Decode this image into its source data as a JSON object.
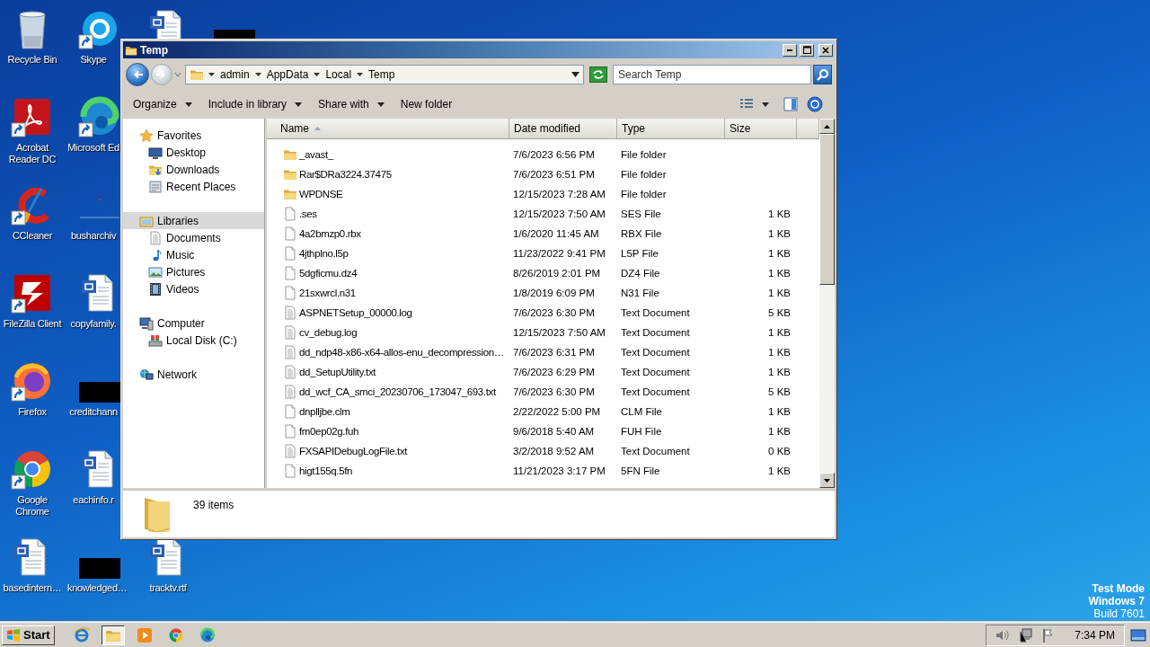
{
  "desktop": {
    "icon_columns": [
      [
        {
          "kind": "recycle-bin",
          "label_lines": [
            "Recycle Bin"
          ],
          "shortcut": false
        },
        {
          "kind": "acrobat",
          "label_lines": [
            "Acrobat",
            "Reader DC"
          ],
          "shortcut": true
        },
        {
          "kind": "ccleaner",
          "label_lines": [
            "CCleaner"
          ],
          "shortcut": true
        },
        {
          "kind": "filezilla",
          "label_lines": [
            "FileZilla Client"
          ],
          "shortcut": true
        },
        {
          "kind": "firefox",
          "label_lines": [
            "Firefox"
          ],
          "shortcut": true
        },
        {
          "kind": "chrome",
          "label_lines": [
            "Google",
            "Chrome"
          ],
          "shortcut": true
        },
        {
          "kind": "word",
          "label_lines": [
            "basedintern…"
          ],
          "shortcut": false
        }
      ],
      [
        {
          "kind": "skype",
          "label_lines": [
            "Skype"
          ],
          "shortcut": true
        },
        {
          "kind": "edge",
          "label_lines": [
            "Microsoft Ed"
          ],
          "shortcut": true
        },
        {
          "kind": "lines",
          "label_lines": [
            "busharchiv"
          ],
          "shortcut": false
        },
        {
          "kind": "word",
          "label_lines": [
            "copyfamily."
          ],
          "shortcut": false
        },
        {
          "kind": "redacted",
          "label_lines": [
            "creditchann"
          ],
          "shortcut": false
        },
        {
          "kind": "word",
          "label_lines": [
            "eachinfo.r"
          ],
          "shortcut": false
        },
        {
          "kind": "redacted",
          "label_lines": [
            "knowledged…"
          ],
          "shortcut": false
        }
      ],
      [
        {
          "kind": "word",
          "shortcut": false
        },
        {
          "kind": "word",
          "label_lines": [
            "tracktv.rtf"
          ],
          "shortcut": false
        }
      ],
      [
        {
          "kind": "redacted",
          "shortcut": false
        }
      ]
    ],
    "notice_lines": [
      "Test Mode",
      "Windows 7",
      "Build 7601"
    ]
  },
  "window": {
    "title": "Temp",
    "nav_buttons": [
      {
        "kind": "back",
        "disabled": false
      },
      {
        "kind": "forward",
        "disabled": true
      }
    ],
    "address": {
      "crumbs": [
        "admin",
        "AppData",
        "Local",
        "Temp"
      ]
    },
    "search": {
      "placeholder": "Search Temp"
    },
    "commands": [
      {
        "label": "Organize",
        "menu": true
      },
      {
        "label": "Include in library",
        "menu": true
      },
      {
        "label": "Share with",
        "menu": true
      },
      {
        "label": "New folder",
        "menu": false
      }
    ],
    "nav": [
      {
        "kind": "favorites",
        "label": "Favorites",
        "selected": false,
        "children": [
          {
            "kind": "desktop",
            "label": "Desktop",
            "selected": false
          },
          {
            "kind": "downloads",
            "label": "Downloads",
            "selected": false
          },
          {
            "kind": "recent",
            "label": "Recent Places",
            "selected": false
          }
        ]
      },
      {
        "kind": "libraries",
        "label": "Libraries",
        "selected": true,
        "children": [
          {
            "kind": "documents",
            "label": "Documents",
            "selected": false
          },
          {
            "kind": "music",
            "label": "Music",
            "selected": false
          },
          {
            "kind": "pictures",
            "label": "Pictures",
            "selected": false
          },
          {
            "kind": "videos",
            "label": "Videos",
            "selected": false
          }
        ]
      },
      {
        "kind": "computer",
        "label": "Computer",
        "selected": false,
        "children": [
          {
            "kind": "disk",
            "label": "Local Disk (C:)",
            "selected": false
          }
        ]
      },
      {
        "kind": "network",
        "label": "Network",
        "selected": false
      }
    ],
    "columns": [
      {
        "label": "Name",
        "sorted": true
      },
      {
        "label": "Date modified",
        "sorted": false
      },
      {
        "label": "Type",
        "sorted": false
      },
      {
        "label": "Size",
        "sorted": false
      }
    ],
    "files": [
      {
        "kind": "folder",
        "name": "_avast_",
        "date": "7/6/2023 6:56 PM",
        "type": "File folder"
      },
      {
        "kind": "folder",
        "name": "Rar$DRa3224.37475",
        "date": "7/6/2023 6:51 PM",
        "type": "File folder"
      },
      {
        "kind": "folder",
        "name": "WPDNSE",
        "date": "12/15/2023 7:28 AM",
        "type": "File folder"
      },
      {
        "kind": "file",
        "name": ".ses",
        "date": "12/15/2023 7:50 AM",
        "type": "SES File",
        "size": "1 KB"
      },
      {
        "kind": "file",
        "name": "4a2bmzp0.rbx",
        "date": "1/6/2020 11:45 AM",
        "type": "RBX File",
        "size": "1 KB"
      },
      {
        "kind": "file",
        "name": "4jthplno.l5p",
        "date": "11/23/2022 9:41 PM",
        "type": "L5P File",
        "size": "1 KB"
      },
      {
        "kind": "file",
        "name": "5dgficmu.dz4",
        "date": "8/26/2019 2:01 PM",
        "type": "DZ4 File",
        "size": "1 KB"
      },
      {
        "kind": "file",
        "name": "21sxwrcl.n31",
        "date": "1/8/2019 6:09 PM",
        "type": "N31 File",
        "size": "1 KB"
      },
      {
        "kind": "text",
        "name": "ASPNETSetup_00000.log",
        "date": "7/6/2023 6:30 PM",
        "type": "Text Document",
        "size": "5 KB"
      },
      {
        "kind": "text",
        "name": "cv_debug.log",
        "date": "12/15/2023 7:50 AM",
        "type": "Text Document",
        "size": "1 KB"
      },
      {
        "kind": "text",
        "name": "dd_ndp48-x86-x64-allos-enu_decompression…",
        "date": "7/6/2023 6:31 PM",
        "type": "Text Document",
        "size": "1 KB"
      },
      {
        "kind": "text",
        "name": "dd_SetupUtility.txt",
        "date": "7/6/2023 6:29 PM",
        "type": "Text Document",
        "size": "1 KB"
      },
      {
        "kind": "text",
        "name": "dd_wcf_CA_smci_20230706_173047_693.txt",
        "date": "7/6/2023 6:30 PM",
        "type": "Text Document",
        "size": "5 KB"
      },
      {
        "kind": "file",
        "name": "dnplljbe.clm",
        "date": "2/22/2022 5:00 PM",
        "type": "CLM File",
        "size": "1 KB"
      },
      {
        "kind": "file",
        "name": "fm0ep02g.fuh",
        "date": "9/6/2018 5:40 AM",
        "type": "FUH File",
        "size": "1 KB"
      },
      {
        "kind": "text",
        "name": "FXSAPIDebugLogFile.txt",
        "date": "3/2/2018 9:52 AM",
        "type": "Text Document",
        "size": "0 KB"
      },
      {
        "kind": "file",
        "name": "higt155q.5fn",
        "date": "11/21/2023 3:17 PM",
        "type": "5FN File",
        "size": "1 KB"
      }
    ],
    "status": {
      "count": "39 items"
    }
  },
  "taskbar": {
    "start": "Start",
    "apps": [
      {
        "kind": "ie",
        "active": false
      },
      {
        "kind": "explorer",
        "active": true
      },
      {
        "kind": "media",
        "active": false
      },
      {
        "kind": "chrome",
        "active": false
      },
      {
        "kind": "edge",
        "active": false
      }
    ],
    "tray": {
      "time": "7:34 PM"
    }
  }
}
